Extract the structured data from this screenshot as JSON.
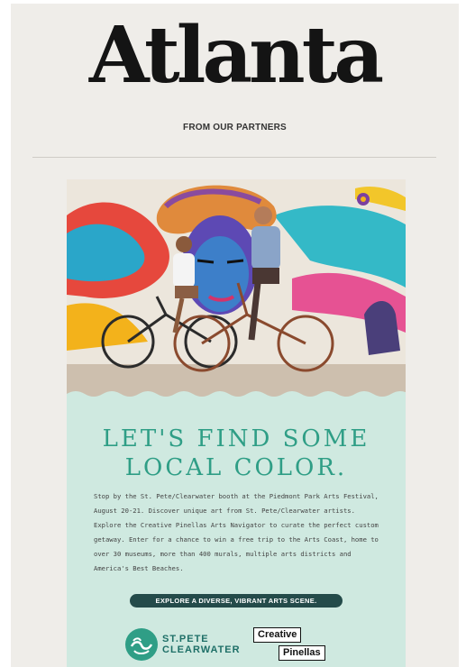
{
  "masthead": {
    "logo_text": "Atlanta",
    "kicker": "FROM OUR PARTNERS"
  },
  "ad": {
    "headline_line1": "LET'S FIND SOME",
    "headline_line2": "LOCAL COLOR.",
    "body": "Stop by the St. Pete/Clearwater booth at the Piedmont Park Arts Festival, August 20-21. Discover unique art from St. Pete/Clearwater artists. Explore the Creative Pinellas Arts Navigator to curate the perfect custom getaway. Enter for a chance to win a free trip to the Arts Coast, home to over 30 museums, more than 400 murals, multiple arts districts and America's Best Beaches.",
    "cta_label": "EXPLORE A DIVERSE, VIBRANT ARTS SCENE.",
    "brand1_line1": "ST.PETE",
    "brand1_line2": "CLEARWATER",
    "brand2_line1": "Creative",
    "brand2_line2": "Pinellas"
  },
  "icons": [
    "wave-logo-icon"
  ],
  "colors": {
    "page_bg": "#efede9",
    "ad_bg": "#cfe9e0",
    "headline": "#2f9e86",
    "cta_bg": "#244b4a"
  }
}
